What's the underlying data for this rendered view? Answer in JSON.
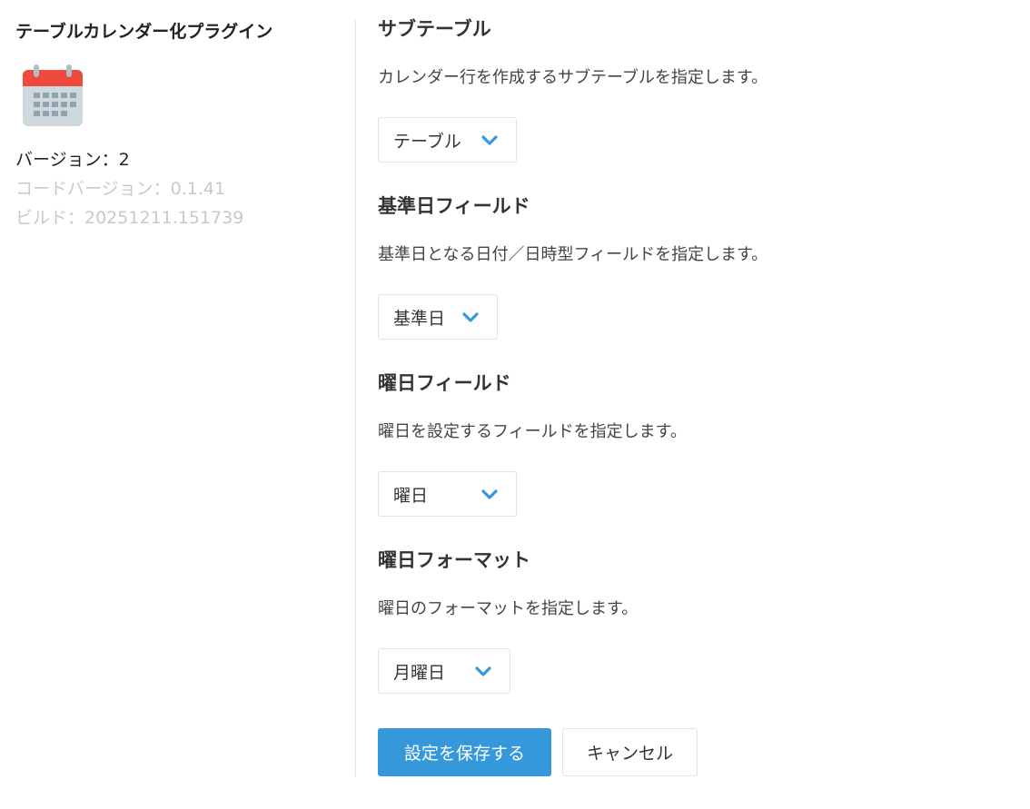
{
  "plugin": {
    "name": "テーブルカレンダー化プラグイン",
    "icon": "calendar-icon",
    "version": "バージョン：2",
    "code_version": "コードバージョン：0.1.41",
    "build": "ビルド：20251211.151739"
  },
  "sections": [
    {
      "title": "サブテーブル",
      "description": "カレンダー行を作成するサブテーブルを指定します。",
      "selected": "テーブル"
    },
    {
      "title": "基準日フィールド",
      "description": "基準日となる日付／日時型フィールドを指定します。",
      "selected": "基準日"
    },
    {
      "title": "曜日フィールド",
      "description": "曜日を設定するフィールドを指定します。",
      "selected": "曜日"
    },
    {
      "title": "曜日フォーマット",
      "description": "曜日のフォーマットを指定します。",
      "selected": "月曜日"
    }
  ],
  "actions": {
    "save_label": "設定を保存する",
    "cancel_label": "キャンセル"
  },
  "colors": {
    "accent": "#3498db",
    "icon_header": "#ef4a3c",
    "icon_body": "#cfd8dc",
    "icon_grid": "#90a4ae"
  }
}
